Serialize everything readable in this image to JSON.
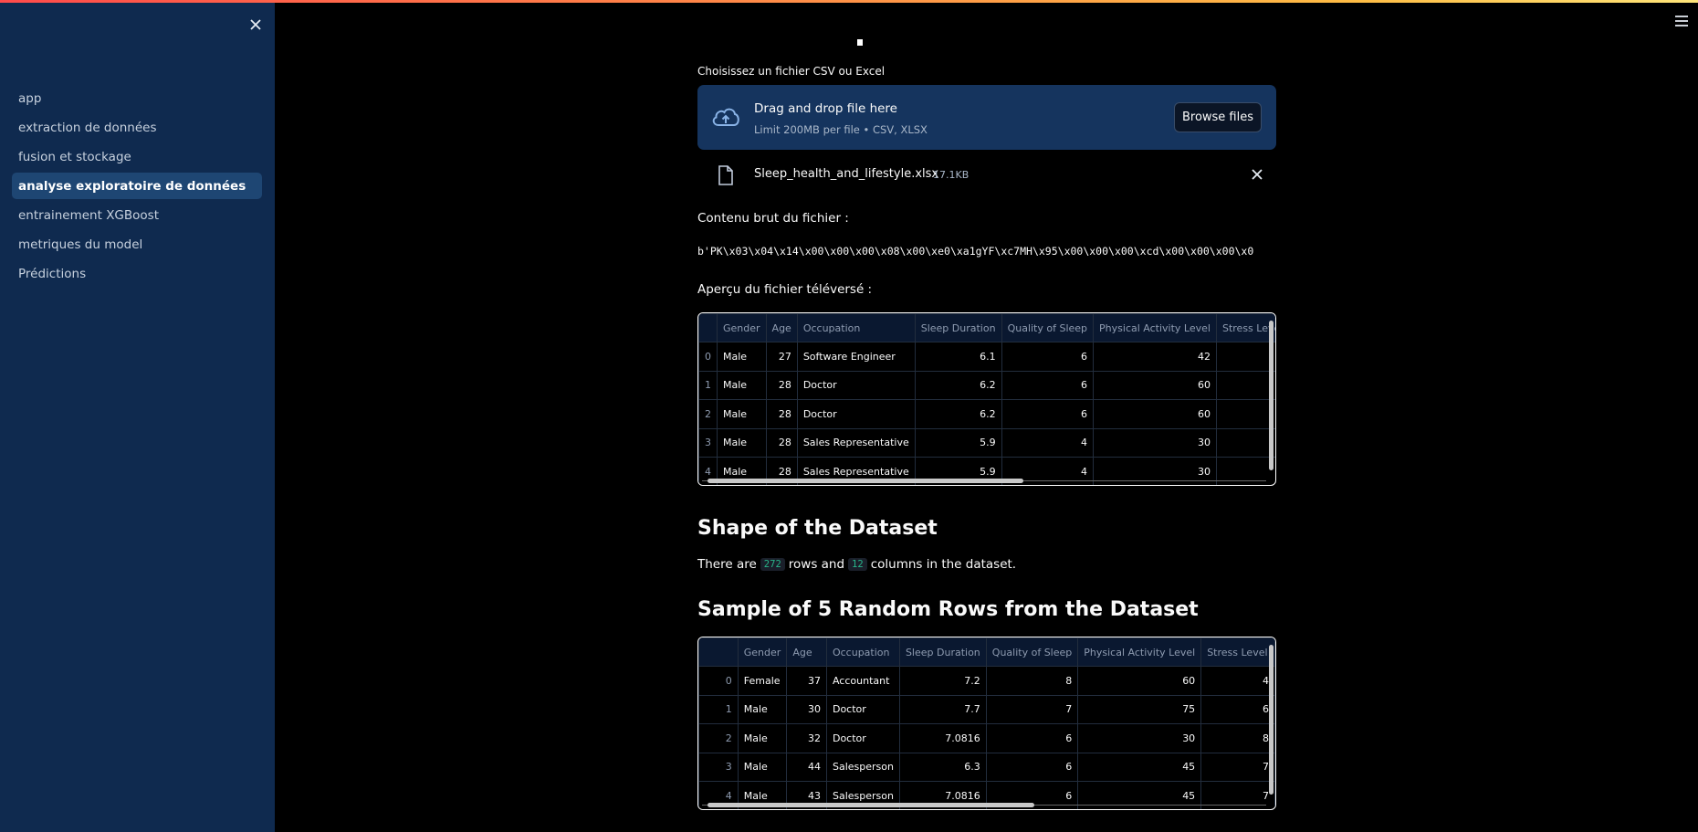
{
  "sidebar": {
    "items": [
      {
        "label": "app",
        "active": false
      },
      {
        "label": "extraction de données",
        "active": false
      },
      {
        "label": "fusion et stockage",
        "active": false
      },
      {
        "label": "analyse exploratoire de données",
        "active": true
      },
      {
        "label": "entrainement XGBoost",
        "active": false
      },
      {
        "label": "metriques du model",
        "active": false
      },
      {
        "label": "Prédictions",
        "active": false
      }
    ]
  },
  "uploader": {
    "label": "Choisissez un fichier CSV ou Excel",
    "drop_title": "Drag and drop file here",
    "drop_sub": "Limit 200MB per file • CSV, XLSX",
    "browse_label": "Browse files",
    "file_name": "Sleep_health_and_lifestyle.xlsx",
    "file_size": "17.1KB"
  },
  "raw": {
    "label": "Contenu brut du fichier :",
    "content": "b'PK\\x03\\x04\\x14\\x00\\x00\\x00\\x08\\x00\\xe0\\xa1gYF\\xc7MH\\x95\\x00\\x00\\x00\\xcd\\x00\\x00\\x00\\x0"
  },
  "preview": {
    "label": "Aperçu du fichier téléversé :",
    "columns": [
      "",
      "Gender",
      "Age",
      "Occupation",
      "Sleep Duration",
      "Quality of Sleep",
      "Physical Activity Level",
      "Stress Level"
    ],
    "rows": [
      [
        "0",
        "Male",
        "27",
        "Software Engineer",
        "6.1",
        "6",
        "42",
        ""
      ],
      [
        "1",
        "Male",
        "28",
        "Doctor",
        "6.2",
        "6",
        "60",
        ""
      ],
      [
        "2",
        "Male",
        "28",
        "Doctor",
        "6.2",
        "6",
        "60",
        ""
      ],
      [
        "3",
        "Male",
        "28",
        "Sales Representative",
        "5.9",
        "4",
        "30",
        ""
      ],
      [
        "4",
        "Male",
        "28",
        "Sales Representative",
        "5.9",
        "4",
        "30",
        ""
      ]
    ],
    "h_scroll_fraction": 0.56
  },
  "shape": {
    "heading": "Shape of the Dataset",
    "text_before": "There are",
    "rows": "272",
    "text_middle": "rows and",
    "cols": "12",
    "text_after": "columns in the dataset."
  },
  "sample": {
    "heading": "Sample of 5 Random Rows from the Dataset",
    "columns": [
      "",
      "Gender",
      "Age",
      "Occupation",
      "Sleep Duration",
      "Quality of Sleep",
      "Physical Activity Level",
      "Stress Level"
    ],
    "rows": [
      [
        "0",
        "Female",
        "37",
        "Accountant",
        "7.2",
        "8",
        "60",
        "4"
      ],
      [
        "1",
        "Male",
        "30",
        "Doctor",
        "7.7",
        "7",
        "75",
        "6"
      ],
      [
        "2",
        "Male",
        "32",
        "Doctor",
        "7.0816",
        "6",
        "30",
        "8"
      ],
      [
        "3",
        "Male",
        "44",
        "Salesperson",
        "6.3",
        "6",
        "45",
        "7"
      ],
      [
        "4",
        "Male",
        "43",
        "Salesperson",
        "7.0816",
        "6",
        "45",
        "7"
      ]
    ],
    "h_scroll_fraction": 0.58
  },
  "colors": {
    "sidebar_bg": "#0f2a4f",
    "sidebar_active": "#1e4673",
    "dropzone_bg": "#15345e",
    "accent_code": "#28b58a"
  }
}
